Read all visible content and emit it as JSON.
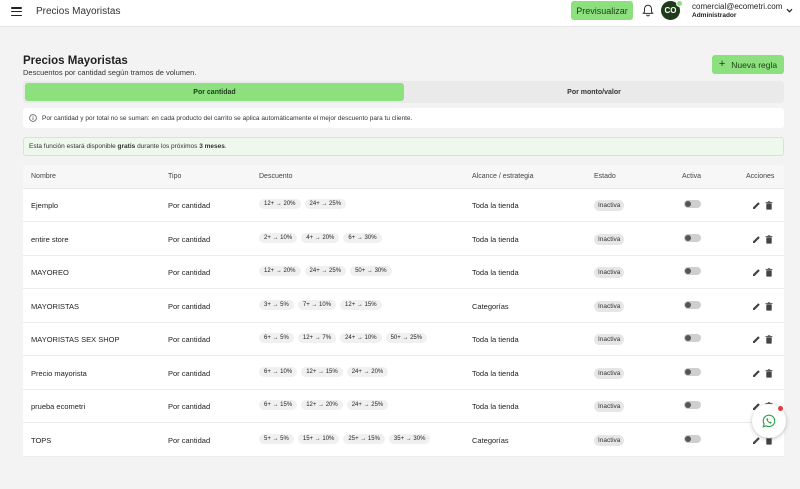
{
  "topbar": {
    "title": "Precios Mayoristas",
    "preview_label": "Previsualizar",
    "avatar_initials": "CO",
    "user_email": "comercial@ecometri.com",
    "user_role": "Administrador",
    "accent_color": "#8ce07e"
  },
  "header": {
    "title": "Precios Mayoristas",
    "subtitle": "Descuentos por cantidad según tramos de volumen.",
    "new_rule_label": "Nueva regla"
  },
  "tabs": [
    {
      "label": "Por cantidad",
      "active": true
    },
    {
      "label": "Por monto/valor",
      "active": false
    }
  ],
  "info": {
    "text": "Por cantidad y por total no se suman: en cada producto del carrito se aplica automáticamente el mejor descuento para tu cliente."
  },
  "promo": {
    "prefix": "Esta función estará disponible",
    "highlight1": "gratis",
    "middle": "durante los próximos",
    "highlight2": "3 meses",
    "suffix": "."
  },
  "table": {
    "headers": {
      "name": "Nombre",
      "type": "Tipo",
      "discount": "Descuento",
      "scope": "Alcance / estrategia",
      "status": "Estado",
      "active": "Activa",
      "actions": "Acciones"
    },
    "rows": [
      {
        "name": "Ejemplo",
        "type": "Por cantidad",
        "discounts": [
          "12+ → 20%",
          "24+ → 25%"
        ],
        "scope": "Toda la tienda",
        "status": "Inactiva"
      },
      {
        "name": "entire store",
        "type": "Por cantidad",
        "discounts": [
          "2+ → 10%",
          "4+ → 20%",
          "6+ → 30%"
        ],
        "scope": "Toda la tienda",
        "status": "Inactiva"
      },
      {
        "name": "MAYOREO",
        "type": "Por cantidad",
        "discounts": [
          "12+ → 20%",
          "24+ → 25%",
          "50+ → 30%"
        ],
        "scope": "Toda la tienda",
        "status": "Inactiva"
      },
      {
        "name": "MAYORISTAS",
        "type": "Por cantidad",
        "discounts": [
          "3+ → 5%",
          "7+ → 10%",
          "12+ → 15%"
        ],
        "scope": "Categorías",
        "status": "Inactiva"
      },
      {
        "name": "MAYORISTAS SEX SHOP",
        "type": "Por cantidad",
        "discounts": [
          "6+ → 5%",
          "12+ → 7%",
          "24+ → 10%",
          "50+ → 25%"
        ],
        "scope": "Toda la tienda",
        "status": "Inactiva"
      },
      {
        "name": "Precio mayorista",
        "type": "Por cantidad",
        "discounts": [
          "6+ → 10%",
          "12+ → 15%",
          "24+ → 20%"
        ],
        "scope": "Toda la tienda",
        "status": "Inactiva"
      },
      {
        "name": "prueba ecometri",
        "type": "Por cantidad",
        "discounts": [
          "6+ → 15%",
          "12+ → 20%",
          "24+ → 25%"
        ],
        "scope": "Toda la tienda",
        "status": "Inactiva"
      },
      {
        "name": "TOPS",
        "type": "Por cantidad",
        "discounts": [
          "5+ → 5%",
          "15+ → 10%",
          "25+ → 15%",
          "35+ → 30%"
        ],
        "scope": "Categorías",
        "status": "Inactiva"
      }
    ]
  }
}
